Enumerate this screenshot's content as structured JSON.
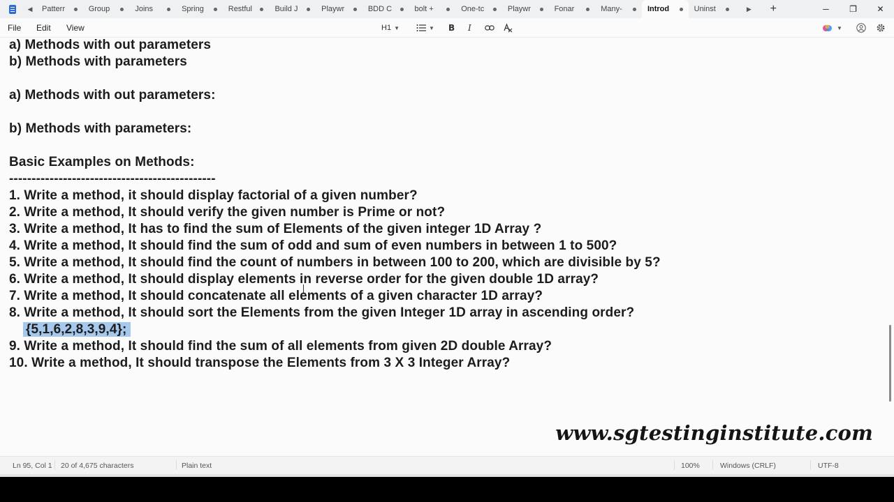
{
  "tabs": [
    {
      "label": "Patterr"
    },
    {
      "label": "Group"
    },
    {
      "label": "Joins"
    },
    {
      "label": "Spring"
    },
    {
      "label": "Restful"
    },
    {
      "label": "Build J"
    },
    {
      "label": "Playwr"
    },
    {
      "label": "BDD C"
    },
    {
      "label": "bolt +"
    },
    {
      "label": "One-tc"
    },
    {
      "label": "Playwr"
    },
    {
      "label": "Fonar"
    },
    {
      "label": "Many-"
    },
    {
      "label": "Introd",
      "active": true
    },
    {
      "label": "Uninst"
    }
  ],
  "window_controls": {
    "minimize": "─",
    "restore": "❐",
    "close": "✕"
  },
  "menu": {
    "file": "File",
    "edit": "Edit",
    "view": "View"
  },
  "toolbar": {
    "heading": "H1",
    "bold": "B",
    "italic": "I"
  },
  "document": {
    "lines": [
      "a) Methods with out parameters",
      "b) Methods with parameters",
      "",
      "a) Methods with out parameters:",
      "",
      "b) Methods with parameters:",
      "",
      "Basic Examples on Methods:",
      "----------------------------------------------",
      "1. Write a method, it should display factorial of a given number?",
      "2. Write a method, It should verify the given number is Prime or not?",
      "3. Write a method, It has to find the sum of Elements of the given integer 1D Array ?",
      "4. Write a method, It should find the sum of odd and sum of even numbers in between 1 to 500?",
      "5. Write a method, It should find the count of numbers in between 100 to 200, which are divisible by 5?",
      "6. Write a method, It should display elements in reverse order for the given double 1D array?",
      "7. Write a method, It should concatenate all elements of a given character 1D array?",
      "8. Write a method, It should sort the Elements from the given Integer 1D array in ascending order?",
      "{5,1,6,2,8,3,9,4};",
      "9. Write a method, It should find the sum of all elements from given 2D double Array?",
      "10. Write a method, It should transpose the Elements from 3 X 3 Integer Array?"
    ],
    "selected_line_index": 17,
    "watermark": "www.sgtestinginstitute.com"
  },
  "status": {
    "position": "Ln 95, Col 1",
    "selection": "20 of 4,675 characters",
    "format": "Plain text",
    "zoom": "100%",
    "line_ending": "Windows (CRLF)",
    "encoding": "UTF-8"
  },
  "colors": {
    "selection": "#a6c8ec",
    "app_icon": "#2c6bd6"
  }
}
